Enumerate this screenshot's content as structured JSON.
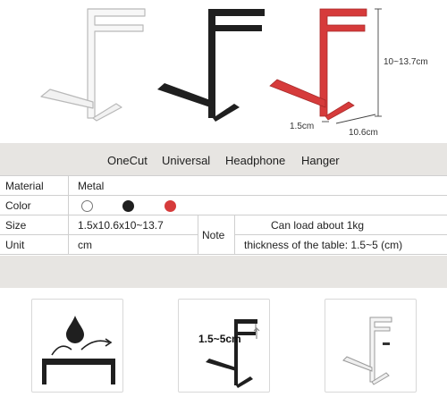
{
  "colors": {
    "white": "#ffffff",
    "black": "#1f1f1f",
    "red": "#d63b3b",
    "band": "#e7e5e2"
  },
  "hero": {
    "height_label": "10~13.7cm",
    "thickness_label": "1.5cm",
    "depth_label": "10.6cm"
  },
  "title": {
    "words": [
      "OneCut",
      "Universal",
      "Headphone",
      "Hanger"
    ]
  },
  "spec": {
    "material_label": "Material",
    "material_value": "Metal",
    "color_label": "Color",
    "size_label": "Size",
    "size_value": "1.5x10.6x10~13.7",
    "unit_label": "Unit",
    "unit_value": "cm",
    "note_label": "Note",
    "note_line1": "Can load about 1kg",
    "note_line2": "thickness of the table: 1.5~5 (cm)"
  },
  "features": {
    "clamp_label": "1.5~5cm"
  }
}
